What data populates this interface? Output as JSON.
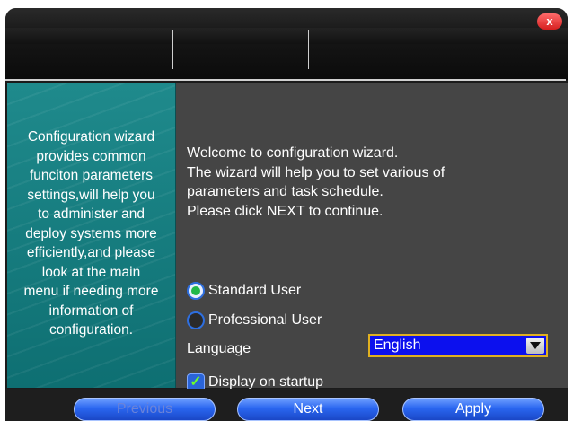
{
  "window": {
    "close_label": "x"
  },
  "sidebar": {
    "description": "Configuration wizard\nprovides common\nfunciton parameters\nsettings,will help you\nto administer and\ndeploy systems more\nefficiently,and please\nlook at the main\nmenu if needing more\ninformation of\nconfiguration."
  },
  "main": {
    "welcome_lines": [
      "Welcome to configuration wizard.",
      "The wizard will help you to set various of",
      "parameters and task schedule.",
      "Please click NEXT to continue."
    ],
    "user_types": [
      {
        "label": "Standard User",
        "selected": true
      },
      {
        "label": "Professional User",
        "selected": false
      }
    ],
    "language": {
      "label": "Language",
      "value": "English"
    },
    "startup": {
      "label": "Display on startup",
      "checked": true
    }
  },
  "footer": {
    "previous_label": "Previous",
    "next_label": "Next",
    "apply_label": "Apply"
  },
  "colors": {
    "sidebar_teal": "#178083",
    "content_gray": "#454545",
    "select_blue": "#0c10ee",
    "button_blue": "#2a66f0"
  }
}
